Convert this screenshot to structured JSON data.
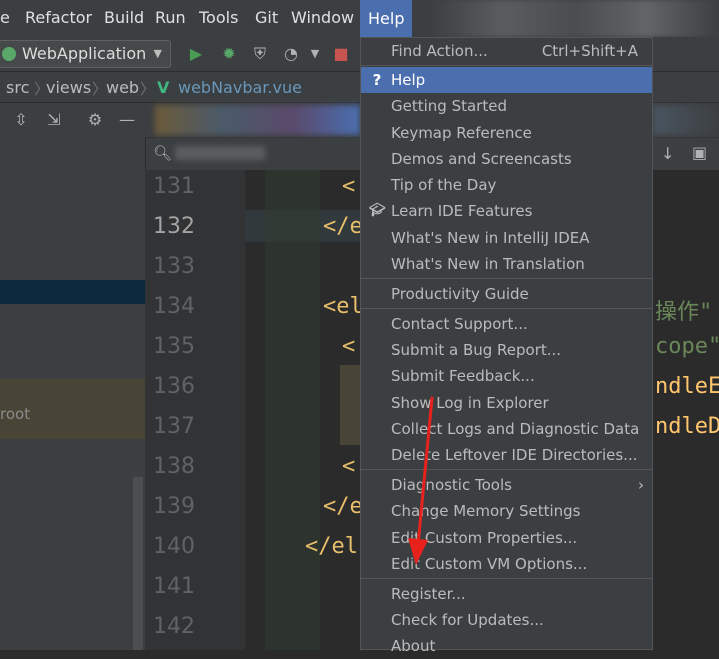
{
  "menubar": {
    "items": [
      "e",
      "Refactor",
      "Build",
      "Run",
      "Tools",
      "Git",
      "Window",
      "Help"
    ]
  },
  "toolbar": {
    "run_config": "WebApplication"
  },
  "breadcrumb": {
    "items": [
      "src",
      "views",
      "web",
      "webNavbar.vue"
    ]
  },
  "editor": {
    "line_numbers": [
      "131",
      "132",
      "133",
      "134",
      "135",
      "136",
      "137",
      "138",
      "139",
      "140",
      "141",
      "142"
    ],
    "code_fragments": [
      "<",
      "</e",
      "<el",
      "<",
      "<",
      "</e",
      "</el-",
      "操作\" fi",
      "cope\"",
      "ndleEc",
      "ndleDe"
    ]
  },
  "help_menu": {
    "items": [
      {
        "label": "Find Action...",
        "shortcut": "Ctrl+Shift+A"
      },
      {
        "label": "Help",
        "icon": "question-icon"
      },
      {
        "label": "Getting Started"
      },
      {
        "label": "Keymap Reference"
      },
      {
        "label": "Demos and Screencasts"
      },
      {
        "label": "Tip of the Day"
      },
      {
        "label": "Learn IDE Features",
        "icon": "graduation-cap-icon"
      },
      {
        "label": "What's New in IntelliJ IDEA"
      },
      {
        "label": "What's New in Translation"
      },
      {
        "label": "Productivity Guide"
      },
      {
        "label": "Contact Support..."
      },
      {
        "label": "Submit a Bug Report..."
      },
      {
        "label": "Submit Feedback..."
      },
      {
        "label": "Show Log in Explorer"
      },
      {
        "label": "Collect Logs and Diagnostic Data"
      },
      {
        "label": "Delete Leftover IDE Directories..."
      },
      {
        "label": "Diagnostic Tools"
      },
      {
        "label": "Change Memory Settings"
      },
      {
        "label": "Edit Custom Properties..."
      },
      {
        "label": "Edit Custom VM Options..."
      },
      {
        "label": "Register..."
      },
      {
        "label": "Check for Updates..."
      },
      {
        "label": "About"
      }
    ]
  },
  "project_pane": {
    "root_label": "root"
  },
  "colors": {
    "accent": "#4b6eaf",
    "annotation_arrow": "#e8211d"
  }
}
